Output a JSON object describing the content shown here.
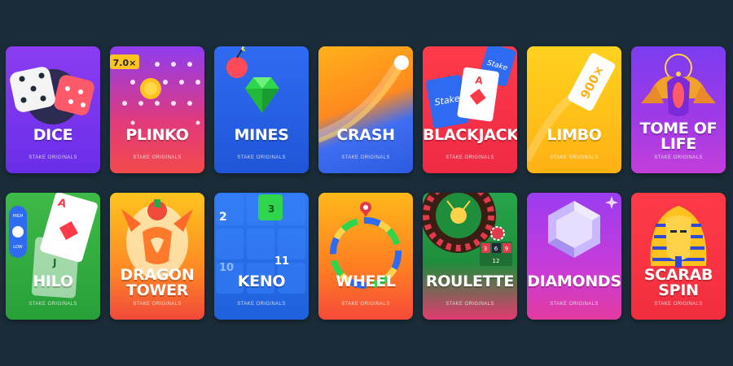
{
  "subtitle": "STAKE ORIGINALS",
  "games": [
    {
      "id": "dice",
      "title": [
        "DICE"
      ]
    },
    {
      "id": "plinko",
      "title": [
        "PLINKO"
      ],
      "badge": "7.0×"
    },
    {
      "id": "mines",
      "title": [
        "MINES"
      ]
    },
    {
      "id": "crash",
      "title": [
        "CRASH"
      ]
    },
    {
      "id": "blackjack",
      "title": [
        "BLACKJACK"
      ],
      "card_text": [
        "Stake",
        "A",
        "Stake"
      ]
    },
    {
      "id": "limbo",
      "title": [
        "LIMBO"
      ],
      "card_text": "900×"
    },
    {
      "id": "tome-of-life",
      "title": [
        "TOME OF",
        "LIFE"
      ]
    },
    {
      "id": "hilo",
      "title": [
        "HILO"
      ],
      "labels": [
        "HIGH",
        "LOW"
      ],
      "card_text": [
        "A",
        "J"
      ]
    },
    {
      "id": "dragon-tower",
      "title": [
        "DRAGON",
        "TOWER"
      ]
    },
    {
      "id": "keno",
      "title": [
        "KENO"
      ],
      "numbers": [
        "2",
        "3",
        "10",
        "11"
      ]
    },
    {
      "id": "wheel",
      "title": [
        "WHEEL"
      ]
    },
    {
      "id": "roulette",
      "title": [
        "ROULETTE"
      ],
      "numbers": [
        "3",
        "6",
        "9",
        "12"
      ]
    },
    {
      "id": "diamonds",
      "title": [
        "DIAMONDS"
      ]
    },
    {
      "id": "scarab-spin",
      "title": [
        "SCARAB",
        "SPIN"
      ]
    }
  ]
}
